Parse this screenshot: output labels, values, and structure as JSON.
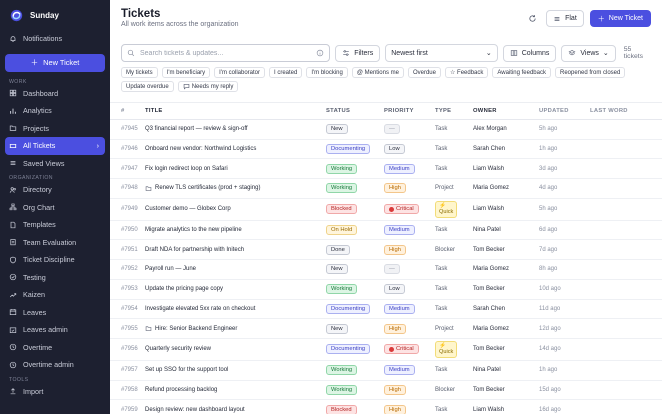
{
  "app": {
    "name": "Sunday"
  },
  "sidebar": {
    "notifications": "Notifications",
    "new_ticket": "New Ticket",
    "sections": {
      "work": "WORK",
      "organization": "ORGANIZATION",
      "tools": "TOOLS"
    },
    "work_items": [
      "Dashboard",
      "Analytics",
      "Projects",
      "All Tickets",
      "Saved Views"
    ],
    "org_items": [
      "Directory",
      "Org Chart",
      "Templates",
      "Team Evaluation",
      "Ticket Discipline",
      "Testing",
      "Kaizen",
      "Leaves",
      "Leaves admin",
      "Overtime",
      "Overtime admin"
    ],
    "tools_items": [
      "Import"
    ]
  },
  "header": {
    "title": "Tickets",
    "subtitle": "All work items across the organization",
    "flat_label": "Flat",
    "new_ticket_label": "New Ticket"
  },
  "toolbar": {
    "search_placeholder": "Search tickets & updates...",
    "filters_label": "Filters",
    "sort_value": "Newest first",
    "columns_label": "Columns",
    "views_label": "Views",
    "count": "55 tickets"
  },
  "chips": [
    "My tickets",
    "I'm beneficiary",
    "I'm collaborator",
    "I created",
    "I'm blocking",
    "@ Mentions me",
    "Overdue",
    "☆ Feedback",
    "Awaiting feedback",
    "Reopened from closed",
    "Update overdue",
    "Needs my reply"
  ],
  "table": {
    "headers": [
      "#",
      "TITLE",
      "STATUS",
      "PRIORITY",
      "TYPE",
      "OWNER",
      "UPDATED",
      "LAST WORD"
    ],
    "rows": [
      {
        "id": "#7945",
        "title": "Q3 financial report — review & sign-off",
        "status": "New",
        "priority": "—",
        "type": "Task",
        "owner": "Alex Morgan",
        "updated": "5h ago",
        "folder": false
      },
      {
        "id": "#7946",
        "title": "Onboard new vendor: Northwind Logistics",
        "status": "Documenting",
        "priority": "Low",
        "type": "Task",
        "owner": "Sarah Chen",
        "updated": "1h ago",
        "folder": false
      },
      {
        "id": "#7947",
        "title": "Fix login redirect loop on Safari",
        "status": "Working",
        "priority": "Medium",
        "type": "Task",
        "owner": "Liam Walsh",
        "updated": "3d ago",
        "folder": false
      },
      {
        "id": "#7948",
        "title": "Renew TLS certificates (prod + staging)",
        "status": "Working",
        "priority": "High",
        "type": "Project",
        "owner": "Maria Gomez",
        "updated": "4d ago",
        "folder": true
      },
      {
        "id": "#7949",
        "title": "Customer demo — Globex Corp",
        "status": "Blocked",
        "priority": "Critical",
        "type": "Quick",
        "owner": "Liam Walsh",
        "updated": "5h ago",
        "folder": false
      },
      {
        "id": "#7950",
        "title": "Migrate analytics to the new pipeline",
        "status": "On Hold",
        "priority": "Medium",
        "type": "Task",
        "owner": "Nina Patel",
        "updated": "6d ago",
        "folder": false
      },
      {
        "id": "#7951",
        "title": "Draft NDA for partnership with Initech",
        "status": "Done",
        "priority": "High",
        "type": "Blocker",
        "owner": "Tom Becker",
        "updated": "7d ago",
        "folder": false
      },
      {
        "id": "#7952",
        "title": "Payroll run — June",
        "status": "New",
        "priority": "—",
        "type": "Task",
        "owner": "Maria Gomez",
        "updated": "8h ago",
        "folder": false
      },
      {
        "id": "#7953",
        "title": "Update the pricing page copy",
        "status": "Working",
        "priority": "Low",
        "type": "Task",
        "owner": "Tom Becker",
        "updated": "10d ago",
        "folder": false
      },
      {
        "id": "#7954",
        "title": "Investigate elevated 5xx rate on checkout",
        "status": "Documenting",
        "priority": "Medium",
        "type": "Task",
        "owner": "Sarah Chen",
        "updated": "11d ago",
        "folder": false
      },
      {
        "id": "#7955",
        "title": "Hire: Senior Backend Engineer",
        "status": "New",
        "priority": "High",
        "type": "Project",
        "owner": "Maria Gomez",
        "updated": "12d ago",
        "folder": true
      },
      {
        "id": "#7956",
        "title": "Quarterly security review",
        "status": "Documenting",
        "priority": "Critical",
        "type": "Quick",
        "owner": "Tom Becker",
        "updated": "14d ago",
        "folder": false
      },
      {
        "id": "#7957",
        "title": "Set up SSO for the support tool",
        "status": "Working",
        "priority": "Medium",
        "type": "Task",
        "owner": "Nina Patel",
        "updated": "1h ago",
        "folder": false
      },
      {
        "id": "#7958",
        "title": "Refund processing backlog",
        "status": "Working",
        "priority": "High",
        "type": "Blocker",
        "owner": "Tom Becker",
        "updated": "15d ago",
        "folder": false
      },
      {
        "id": "#7959",
        "title": "Design review: new dashboard layout",
        "status": "Blocked",
        "priority": "High",
        "type": "Task",
        "owner": "Liam Walsh",
        "updated": "16d ago",
        "folder": false
      }
    ]
  },
  "colors": {
    "sidebar_bg": "#1d2030",
    "accent": "#4b4fe0"
  }
}
